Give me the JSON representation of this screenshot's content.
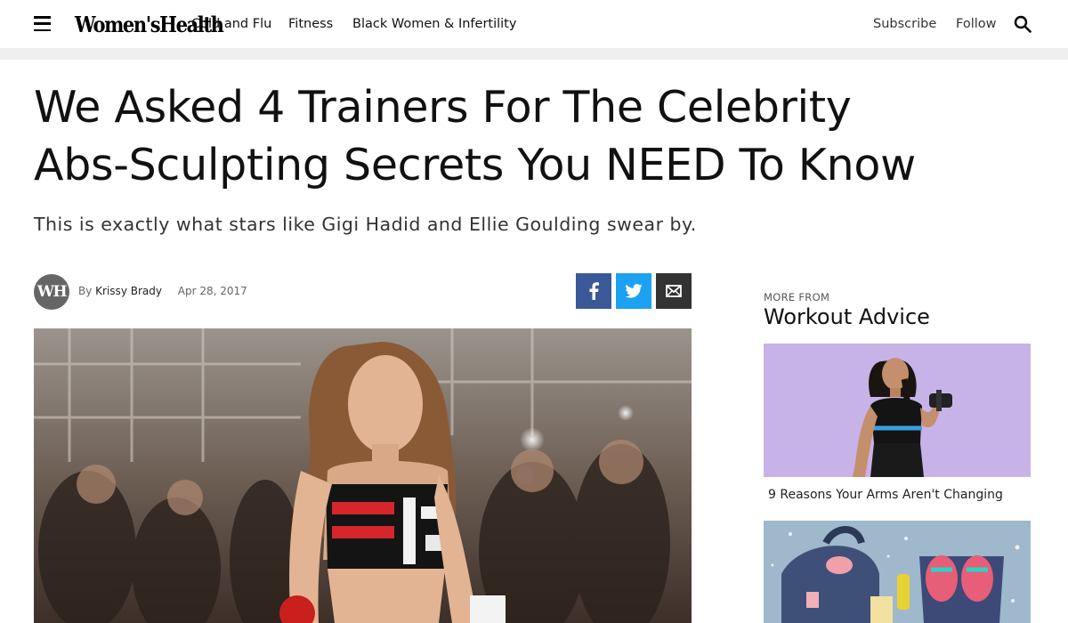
{
  "nav": {
    "logo": "Women'sHealth",
    "links": [
      "Cold and Flu",
      "Fitness",
      "Black Women & Infertility"
    ],
    "subscribe": "Subscribe",
    "follow": "Follow"
  },
  "article": {
    "headline_line1": "We Asked 4 Trainers For The Celebrity",
    "headline_line2": "Abs-Sculpting Secrets You NEED To Know",
    "dek": "This is exactly what stars like Gigi Hadid and Ellie Goulding swear by.",
    "avatar_initials": "WH",
    "by": "By",
    "author": "Krissy Brady",
    "date": "Apr 28, 2017"
  },
  "share": {
    "icons": [
      "facebook-icon",
      "twitter-icon",
      "email-icon"
    ]
  },
  "sidebar": {
    "more_from": "MORE FROM",
    "section_title": "Workout Advice",
    "cards": [
      {
        "caption": "9 Reasons Your Arms Aren't Changing"
      }
    ]
  },
  "colors": {
    "facebook": "#3b5998",
    "twitter": "#1da1f2",
    "email": "#333333"
  }
}
